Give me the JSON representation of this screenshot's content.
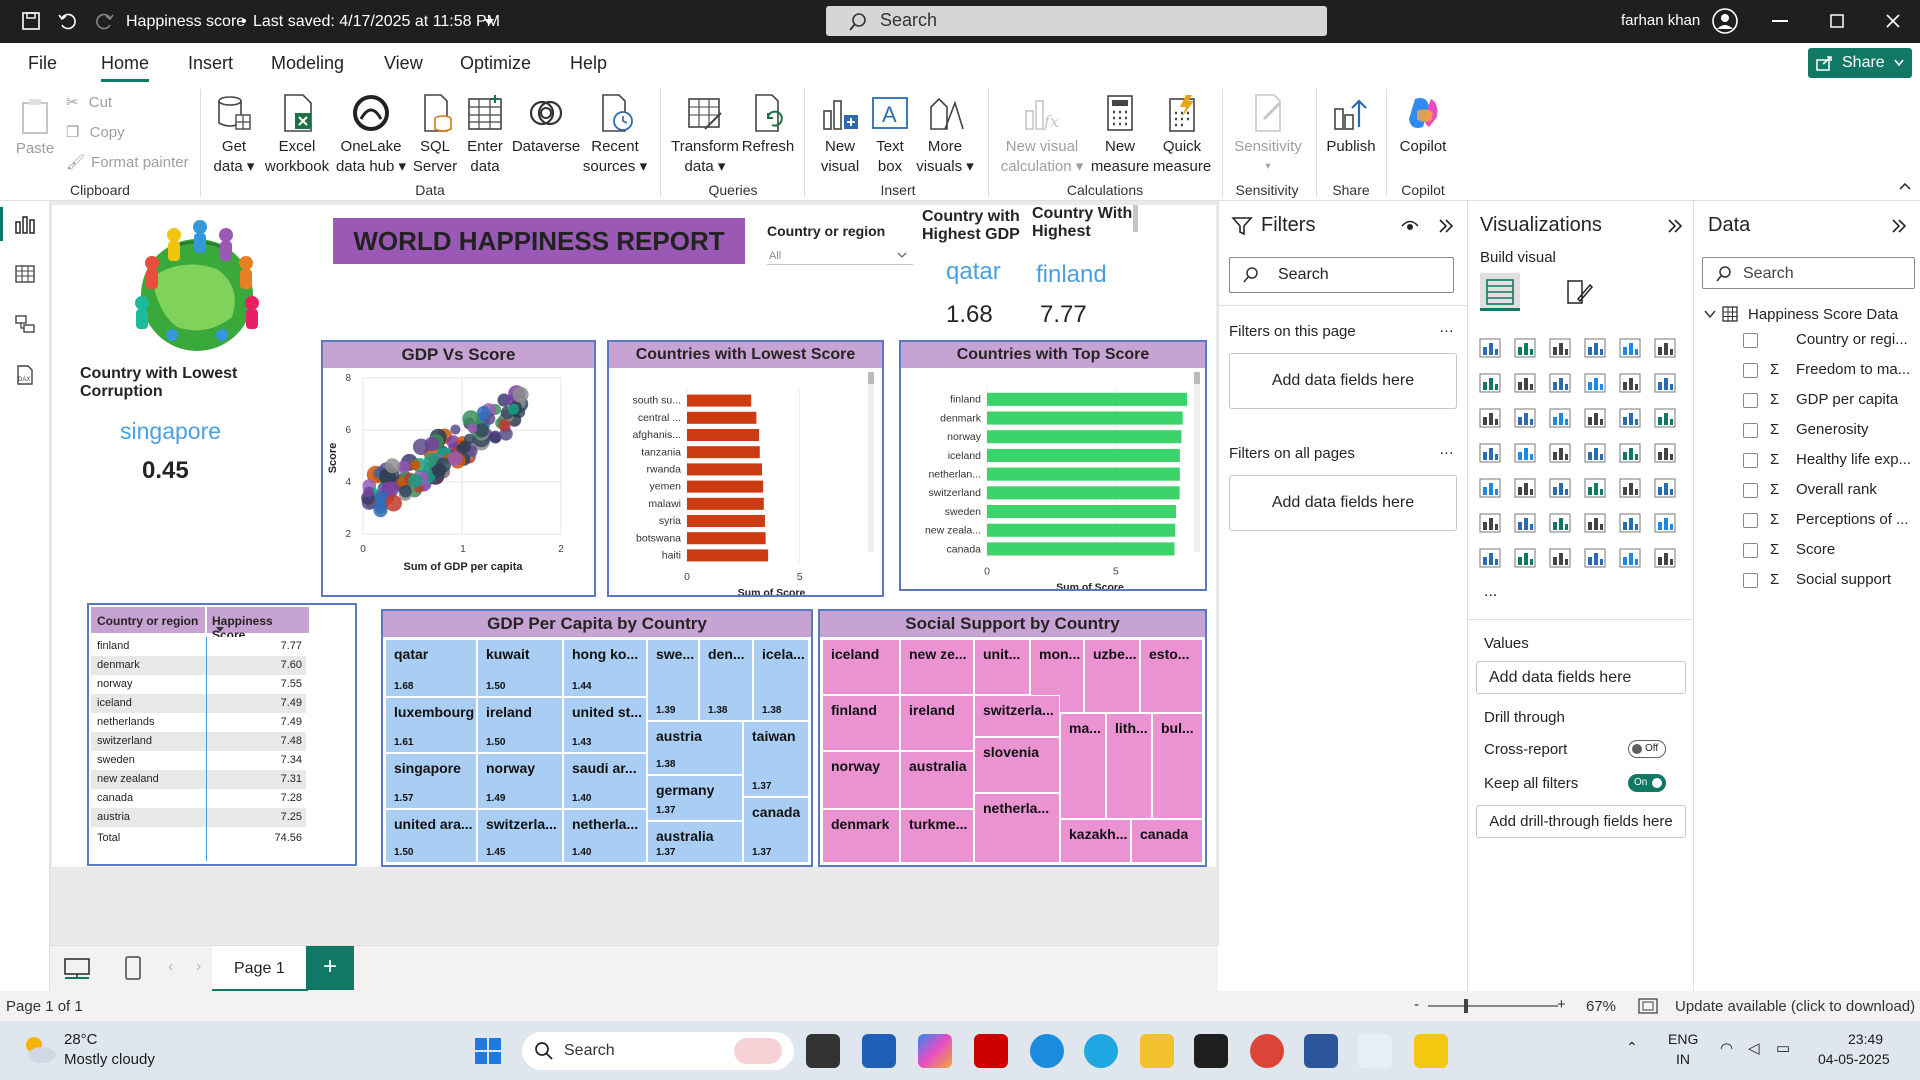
{
  "titlebar": {
    "title": "Happiness score",
    "saved": "Last saved: 4/17/2025 at 11:58 PM",
    "search_placeholder": "Search",
    "user": "farhan khan"
  },
  "menu": [
    "File",
    "Home",
    "Insert",
    "Modeling",
    "View",
    "Optimize",
    "Help"
  ],
  "share_label": "Share",
  "ribbon": {
    "paste": "Paste",
    "cut": "Cut",
    "copy": "Copy",
    "format_painter": "Format painter",
    "clipboard": "Clipboard",
    "get_data": [
      "Get",
      "data"
    ],
    "excel": [
      "Excel",
      "workbook"
    ],
    "onelake": [
      "OneLake",
      "data hub"
    ],
    "sql": [
      "SQL",
      "Server"
    ],
    "enter_data": [
      "Enter",
      "data"
    ],
    "dataverse": "Dataverse",
    "recent": [
      "Recent",
      "sources"
    ],
    "data_group": "Data",
    "transform": [
      "Transform",
      "data"
    ],
    "refresh": "Refresh",
    "queries_group": "Queries",
    "new_visual": [
      "New",
      "visual"
    ],
    "text_box": [
      "Text",
      "box"
    ],
    "more_visuals": [
      "More",
      "visuals"
    ],
    "insert_group": "Insert",
    "new_visual_calc": [
      "New visual",
      "calculation"
    ],
    "new_measure": [
      "New",
      "measure"
    ],
    "quick_measure": [
      "Quick",
      "measure"
    ],
    "calc_group": "Calculations",
    "sensitivity": "Sensitivity",
    "sensitivity_group": "Sensitivity",
    "publish": "Publish",
    "share_group": "Share",
    "copilot": "Copilot",
    "copilot_group": "Copilot"
  },
  "report": {
    "title": "WORLD HAPPINESS REPORT",
    "slicer_label": "Country or region",
    "slicer_value": "All",
    "card_gdp_title": [
      "Country with",
      "Highest GDP"
    ],
    "card_gdp_country": "qatar",
    "card_gdp_value": "1.68",
    "card_highest_title": [
      "Country With",
      "Highest"
    ],
    "card_highest_country": "finland",
    "card_highest_value": "7.77",
    "card_corruption_title": [
      "Country with Lowest",
      "Corruption"
    ],
    "card_corruption_country": "singapore",
    "card_corruption_value": "0.45"
  },
  "scatter": {
    "title": "GDP Vs Score",
    "xlabel": "Sum of GDP per capita",
    "ylabel": "Score",
    "xticks": [
      "0",
      "1",
      "2"
    ],
    "yticks": [
      "2",
      "4",
      "6",
      "8"
    ]
  },
  "lowest_chart": {
    "title": "Countries with Lowest Score",
    "xlabel": "Sum of Score",
    "xticks": [
      "0",
      "5"
    ],
    "categories": [
      "south su...",
      "central ...",
      "afghanis...",
      "tanzania",
      "rwanda",
      "yemen",
      "malawi",
      "syria",
      "botswana",
      "haiti"
    ],
    "values": [
      2.85,
      3.08,
      3.2,
      3.23,
      3.33,
      3.38,
      3.41,
      3.46,
      3.49,
      3.6
    ],
    "xlim": [
      0,
      7.5
    ],
    "color": "#cc3b12"
  },
  "top_chart": {
    "title": "Countries with Top Score",
    "xlabel": "Sum of Score",
    "xticks": [
      "0",
      "5"
    ],
    "categories": [
      "finland",
      "denmark",
      "norway",
      "iceland",
      "netherlan...",
      "switzerland",
      "sweden",
      "new zeala...",
      "canada"
    ],
    "values": [
      7.77,
      7.6,
      7.55,
      7.49,
      7.49,
      7.48,
      7.34,
      7.31,
      7.28
    ],
    "xlim": [
      0,
      8
    ],
    "color": "#3cd46a"
  },
  "table": {
    "col1": "Country or region",
    "col2": "Happiness Score",
    "rows": [
      [
        "finland",
        "7.77"
      ],
      [
        "denmark",
        "7.60"
      ],
      [
        "norway",
        "7.55"
      ],
      [
        "iceland",
        "7.49"
      ],
      [
        "netherlands",
        "7.49"
      ],
      [
        "switzerland",
        "7.48"
      ],
      [
        "sweden",
        "7.34"
      ],
      [
        "new zealand",
        "7.31"
      ],
      [
        "canada",
        "7.28"
      ],
      [
        "austria",
        "7.25"
      ]
    ],
    "total_label": "Total",
    "total_value": "74.56"
  },
  "gdp_treemap": {
    "title": "GDP Per Capita by Country",
    "cells": [
      {
        "label": "qatar",
        "value": "1.68"
      },
      {
        "label": "kuwait",
        "value": "1.50"
      },
      {
        "label": "hong ko...",
        "value": "1.44"
      },
      {
        "label": "swe...",
        "value": "1.39"
      },
      {
        "label": "den...",
        "value": "1.38"
      },
      {
        "label": "icela...",
        "value": "1.38"
      },
      {
        "label": "luxembourg",
        "value": "1.61"
      },
      {
        "label": "ireland",
        "value": "1.50"
      },
      {
        "label": "united st...",
        "value": "1.43"
      },
      {
        "label": "austria",
        "value": "1.38"
      },
      {
        "label": "taiwan",
        "value": "1.37"
      },
      {
        "label": "singapore",
        "value": "1.57"
      },
      {
        "label": "norway",
        "value": "1.49"
      },
      {
        "label": "saudi ar...",
        "value": "1.40"
      },
      {
        "label": "germany",
        "value": "1.37"
      },
      {
        "label": "canada",
        "value": "1.37"
      },
      {
        "label": "united ara...",
        "value": "1.50"
      },
      {
        "label": "switzerla...",
        "value": "1.45"
      },
      {
        "label": "netherla...",
        "value": "1.40"
      },
      {
        "label": "australia",
        "value": "1.37"
      }
    ],
    "color": "#a9cdf3"
  },
  "social_treemap": {
    "title": "Social Support by Country",
    "cells": [
      "iceland",
      "new ze...",
      "unit...",
      "mon...",
      "uzbe...",
      "esto...",
      "finland",
      "ireland",
      "switzerla...",
      "ma...",
      "lith...",
      "bul...",
      "norway",
      "australia",
      "slovenia",
      "denmark",
      "turkme...",
      "netherla...",
      "kazakh...",
      "canada"
    ],
    "color": "#ea92d2"
  },
  "filters": {
    "title": "Filters",
    "search": "Search",
    "on_page": "Filters on this page",
    "on_all": "Filters on all pages",
    "add": "Add data fields here"
  },
  "viz": {
    "title": "Visualizations",
    "build": "Build visual",
    "values": "Values",
    "values_add": "Add data fields here",
    "drill": "Drill through",
    "cross_report": "Cross-report",
    "cross_state": "Off",
    "keep_filters": "Keep all filters",
    "keep_state": "On",
    "drill_add": "Add drill-through fields here",
    "more": "..."
  },
  "data_pane": {
    "title": "Data",
    "search": "Search",
    "table_name": "Happiness Score Data",
    "fields": [
      {
        "name": "Country or regi...",
        "sigma": false
      },
      {
        "name": "Freedom to ma...",
        "sigma": true
      },
      {
        "name": "GDP per capita",
        "sigma": true
      },
      {
        "name": "Generosity",
        "sigma": true
      },
      {
        "name": "Healthy life exp...",
        "sigma": true
      },
      {
        "name": "Overall rank",
        "sigma": true
      },
      {
        "name": "Perceptions of ...",
        "sigma": true
      },
      {
        "name": "Score",
        "sigma": true
      },
      {
        "name": "Social support",
        "sigma": true
      }
    ]
  },
  "pagebar": {
    "page": "Page 1",
    "add": "+"
  },
  "status": {
    "page_of": "Page 1 of 1",
    "zoom": "67%",
    "update": "Update available (click to download)"
  },
  "taskbar": {
    "temp": "28°C",
    "weather": "Mostly cloudy",
    "search": "Search",
    "lang1": "ENG",
    "lang2": "IN",
    "time": "23:49",
    "date": "04-05-2025"
  },
  "colors": {
    "accent": "#117865",
    "title_purple": "#9b59b6",
    "header_purple": "#c7a3d3",
    "card_blue": "#4a9fe0",
    "border_blue": "#5a79c4"
  }
}
